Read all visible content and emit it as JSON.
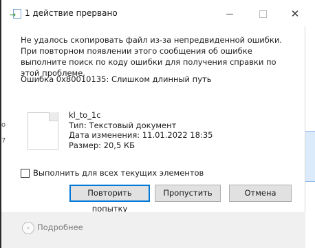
{
  "window": {
    "title": "1 действие прервано",
    "min_glyph": "",
    "close_glyph": "✕"
  },
  "message": {
    "text": "Не удалось скопировать файл из-за непредвиденной ошибки. При повторном появлении этого сообщения об ошибке выполните поиск по коду ошибки для получения справки по этой проблеме.",
    "error": "Ошибка 0x80010135: Слишком длинный путь"
  },
  "file": {
    "name": "kl_to_1c",
    "type": "Тип: Текстовый документ",
    "modified": "Дата изменения: 11.01.2022 18:35",
    "size": "Размер: 20,5 КБ"
  },
  "side_marks": [
    "o",
    "7"
  ],
  "options": {
    "apply_all_label": "Выполнить для всех текущих элементов",
    "apply_all_checked": false
  },
  "buttons": {
    "retry": "Повторить попытку",
    "skip": "Пропустить",
    "cancel": "Отмена"
  },
  "footer": {
    "more_label": "Подробнее",
    "more_glyph": "⌄"
  },
  "colors": {
    "accent": "#0078d7",
    "button_bg": "#e1e1e1",
    "footer_bg": "#f0f0f0"
  }
}
